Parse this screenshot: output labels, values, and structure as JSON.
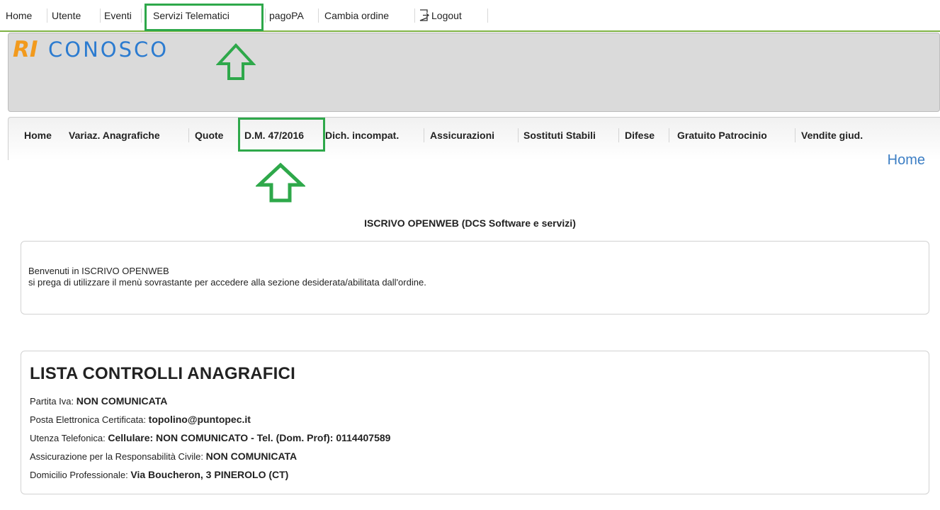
{
  "topnav": {
    "items": [
      "Home",
      "Utente",
      "Eventi",
      "Servizi Telematici",
      "pagoPA",
      "Cambia ordine",
      "Logout"
    ]
  },
  "banner": {
    "logo_prefix": "RI",
    "logo_suffix": "CONOSCO"
  },
  "subnav": {
    "items": [
      "Home",
      "Variaz. Anagrafiche",
      "Quote",
      "D.M. 47/2016",
      "Dich. incompat.",
      "Assicurazioni",
      "Sostituti Stabili",
      "Difese",
      "Gratuito Patrocinio",
      "Vendite giud."
    ]
  },
  "page": {
    "heading": "Home",
    "site_title": "ISCRIVO OPENWEB (DCS Software e servizi)"
  },
  "welcome": {
    "line1": "Benvenuti in ISCRIVO OPENWEB",
    "line2": "si prega di utilizzare il menù sovrastante per accedere alla sezione desiderata/abilitata dall'ordine."
  },
  "controls": {
    "title": "LISTA CONTROLLI ANAGRAFICI",
    "rows": [
      {
        "label": "Partita Iva:",
        "value": "NON COMUNICATA"
      },
      {
        "label": "Posta Elettronica Certificata:",
        "value": "topolino@puntopec.it"
      },
      {
        "label": "Utenza Telefonica:",
        "value": "Cellulare: NON COMUNICATO - Tel. (Dom. Prof): 0114407589"
      },
      {
        "label": "Assicurazione per la Responsabilità Civile:",
        "value": "NON COMUNICATA"
      },
      {
        "label": "Domicilio Professionale:",
        "value": "Via Boucheron, 3 PINEROLO (CT)"
      }
    ]
  },
  "colors": {
    "highlight": "#2ea84a",
    "accent_link": "#3c7ec4",
    "logo_orange": "#f29a1d",
    "logo_blue": "#2b7bd0"
  },
  "icons": {
    "logout": "logout-icon",
    "annotation": "up-arrow-icon"
  }
}
